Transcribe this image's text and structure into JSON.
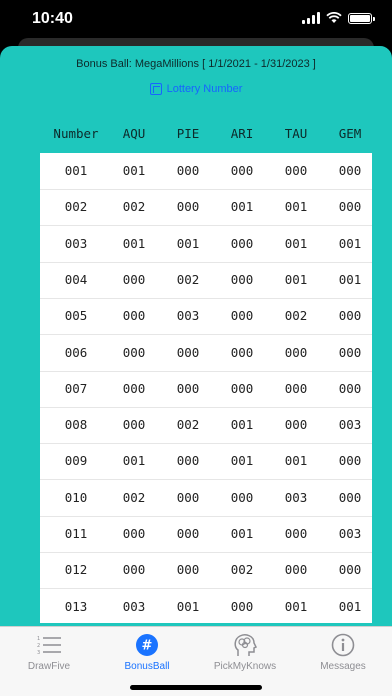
{
  "status": {
    "time": "10:40"
  },
  "header": {
    "title": "Bonus Ball: MegaMillions  [ 1/1/2021 - 1/31/2023 ]",
    "link_label": "Lottery Number"
  },
  "columns": [
    "Number",
    "AQU",
    "PIE",
    "ARI",
    "TAU",
    "GEM"
  ],
  "rows": [
    [
      "001",
      "001",
      "000",
      "000",
      "000",
      "000"
    ],
    [
      "002",
      "002",
      "000",
      "001",
      "001",
      "000"
    ],
    [
      "003",
      "001",
      "001",
      "000",
      "001",
      "001"
    ],
    [
      "004",
      "000",
      "002",
      "000",
      "001",
      "001"
    ],
    [
      "005",
      "000",
      "003",
      "000",
      "002",
      "000"
    ],
    [
      "006",
      "000",
      "000",
      "000",
      "000",
      "000"
    ],
    [
      "007",
      "000",
      "000",
      "000",
      "000",
      "000"
    ],
    [
      "008",
      "000",
      "002",
      "001",
      "000",
      "003"
    ],
    [
      "009",
      "001",
      "000",
      "001",
      "001",
      "000"
    ],
    [
      "010",
      "002",
      "000",
      "000",
      "003",
      "000"
    ],
    [
      "011",
      "000",
      "000",
      "001",
      "000",
      "003"
    ],
    [
      "012",
      "000",
      "000",
      "002",
      "000",
      "000"
    ],
    [
      "013",
      "003",
      "001",
      "000",
      "001",
      "001"
    ]
  ],
  "tabs": [
    {
      "label": "DrawFive",
      "icon": "numbered-list-icon",
      "active": false
    },
    {
      "label": "BonusBall",
      "icon": "hash-icon",
      "active": true
    },
    {
      "label": "PickMyKnows",
      "icon": "brain-head-icon",
      "active": false
    },
    {
      "label": "Messages",
      "icon": "info-icon",
      "active": false
    }
  ],
  "colors": {
    "accent": "#1ec7bd",
    "tab_active": "#1a73ff",
    "link": "#1864ff"
  }
}
